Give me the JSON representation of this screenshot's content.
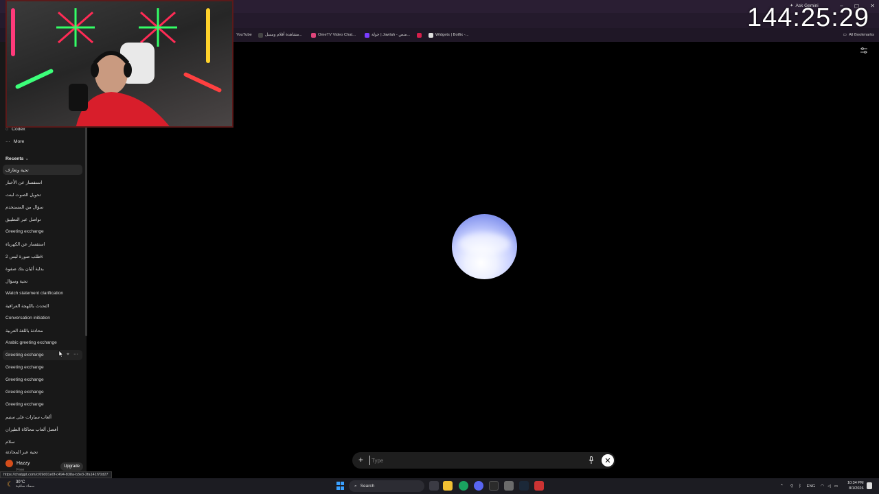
{
  "browser": {
    "ask_gemini": "Ask Gemini",
    "window_controls": [
      "–",
      "▢",
      "✕"
    ],
    "bookmarks": [
      {
        "label": "YouTube",
        "color": "#ff0000"
      },
      {
        "label": "مشاهدة أفلام ومسل...",
        "color": "#444444"
      },
      {
        "label": "OmeTV Video Chat...",
        "color": "#e0457b"
      },
      {
        "label": "جولة | Jawlah - منص...",
        "color": "#7a3cff"
      },
      {
        "label": "",
        "color": "#d61f4b"
      },
      {
        "label": "Widgets | Botfix -...",
        "color": "#dddddd"
      }
    ],
    "all_bookmarks": "All Bookmarks"
  },
  "overlay": {
    "timer": "144:25:29"
  },
  "sidebar": {
    "nav": [
      {
        "label": "Codex",
        "icon": "codex-icon"
      },
      {
        "label": "More",
        "icon": "more-dots-icon"
      }
    ],
    "recents_label": "Recents",
    "recents": [
      "تحية وتعارف",
      "استفسار عن الأخبار",
      "تحويل الصوت لبنت",
      "سؤال من المستخدم",
      "تواصل عبر التطبيق",
      "Greeting exchange",
      "استفسار عن الكهرباء",
      "طلب صورة لبس 2k",
      "بداية أليان بتك صفوة",
      "تحية وسؤال",
      "Watch statement clarification",
      "التحدث باللهجة العراقية",
      "Conversation initiation",
      "محادثة باللغة العربية",
      "Arabic greeting exchange",
      "Greeting exchange",
      "Greeting exchange",
      "Greeting exchange",
      "Greeting exchange",
      "Greeting exchange",
      "ألعاب سيارات على ستيم",
      "أفضل ألعاب محاكاة الطيران",
      "سلام",
      "تحية عبر المحادثة"
    ],
    "user_name": "Hazzy",
    "user_plan": "Free",
    "upgrade_label": "Upgrade",
    "status_url": "https://chatgpt.com/c/69d01e0f-c494-838a-b3e3-2fa141f70d27"
  },
  "composer": {
    "placeholder": "Type",
    "value": ""
  },
  "taskbar": {
    "weather_temp": "30°C",
    "weather_desc": "سماء صافية",
    "search_label": "Search",
    "language": "ENG",
    "time": "10:34 PM",
    "date": "8/1/2026"
  }
}
